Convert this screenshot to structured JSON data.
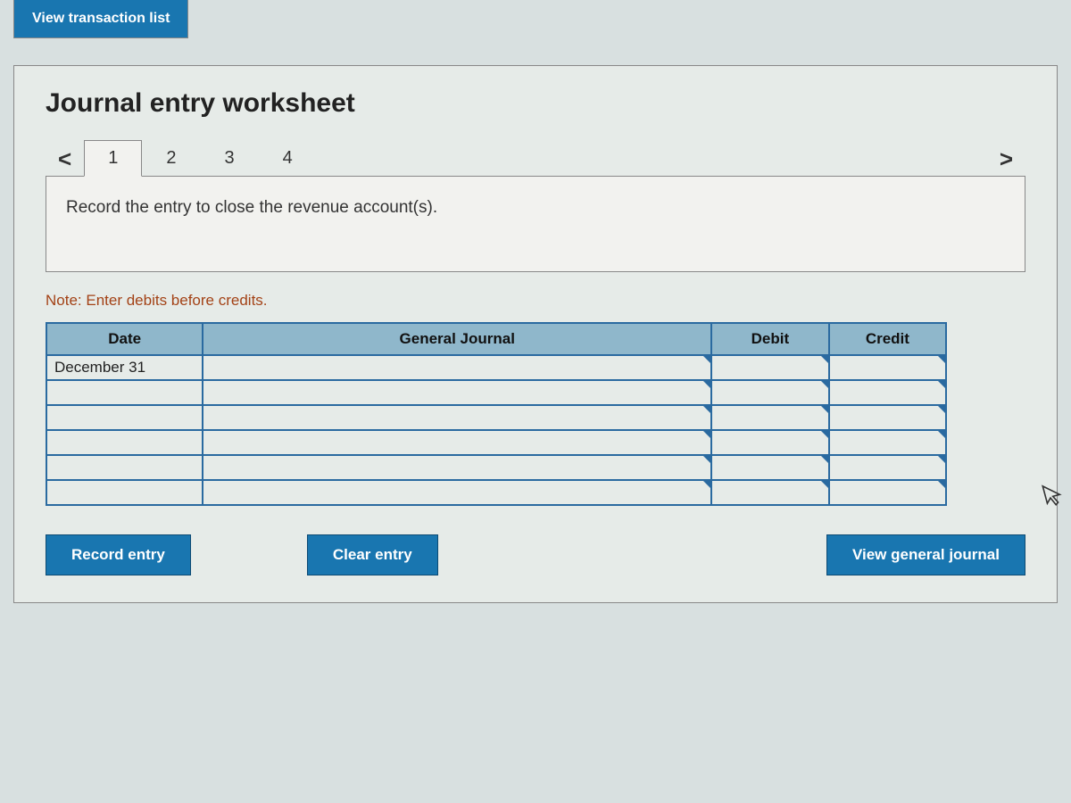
{
  "topTab": "View transaction list",
  "panel": {
    "title": "Journal entry worksheet",
    "navPrev": "<",
    "navNext": ">",
    "steps": [
      "1",
      "2",
      "3",
      "4"
    ],
    "activeStep": 0,
    "prompt": "Record the entry to close the revenue account(s).",
    "note": "Note: Enter debits before credits.",
    "headers": {
      "date": "Date",
      "journal": "General Journal",
      "debit": "Debit",
      "credit": "Credit"
    },
    "rows": [
      {
        "date": "December 31",
        "journal": "",
        "debit": "",
        "credit": ""
      },
      {
        "date": "",
        "journal": "",
        "debit": "",
        "credit": ""
      },
      {
        "date": "",
        "journal": "",
        "debit": "",
        "credit": ""
      },
      {
        "date": "",
        "journal": "",
        "debit": "",
        "credit": ""
      },
      {
        "date": "",
        "journal": "",
        "debit": "",
        "credit": ""
      },
      {
        "date": "",
        "journal": "",
        "debit": "",
        "credit": ""
      }
    ],
    "buttons": {
      "record": "Record entry",
      "clear": "Clear entry",
      "viewJournal": "View general journal"
    }
  }
}
